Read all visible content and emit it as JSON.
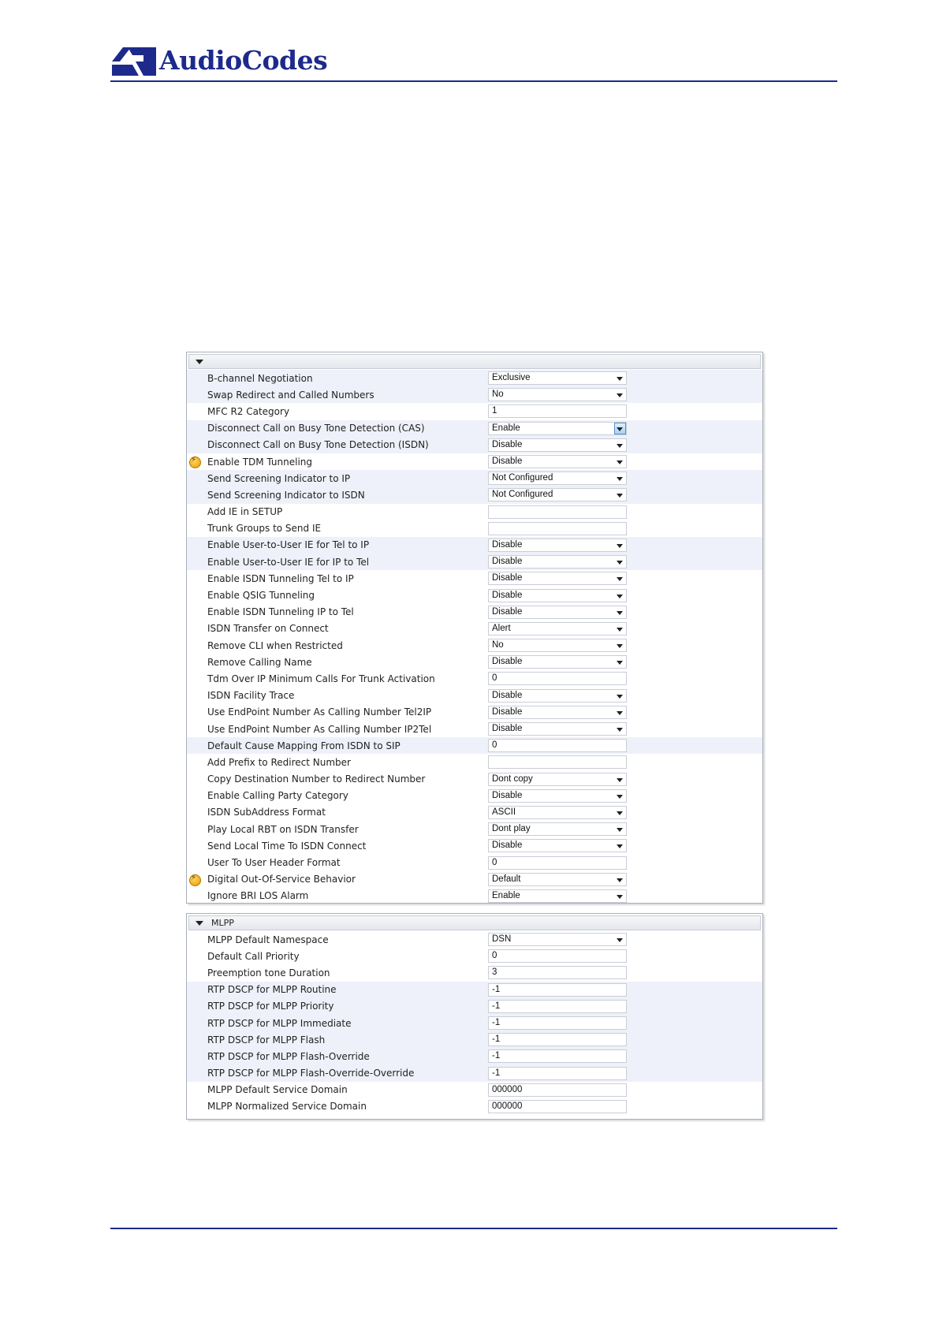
{
  "header": {
    "brand": "AudioCodes"
  },
  "colors": {
    "brand": "#1d2a8c",
    "row_alt": "#eef1f9",
    "border": "#a9b0ba"
  },
  "panel1": {
    "title": "",
    "rows": [
      {
        "label": "B-channel Negotiation",
        "value": "Exclusive",
        "type": "select"
      },
      {
        "label": "Swap Redirect and Called Numbers",
        "value": "No",
        "type": "select"
      },
      {
        "label": "MFC R2 Category",
        "value": "1",
        "type": "text"
      },
      {
        "label": "Disconnect Call on Busy Tone Detection (CAS)",
        "value": "Enable",
        "type": "select",
        "focused": true
      },
      {
        "label": "Disconnect Call on Busy Tone Detection (ISDN)",
        "value": "Disable",
        "type": "select"
      },
      {
        "label": "Enable TDM Tunneling",
        "value": "Disable",
        "type": "select",
        "flag": true
      },
      {
        "label": "Send Screening Indicator to IP",
        "value": "Not Configured",
        "type": "select"
      },
      {
        "label": "Send Screening Indicator to ISDN",
        "value": "Not Configured",
        "type": "select"
      },
      {
        "label": "Add IE in SETUP",
        "value": "",
        "type": "text"
      },
      {
        "label": "Trunk Groups to Send IE",
        "value": "",
        "type": "text"
      },
      {
        "label": "Enable User-to-User IE for Tel to IP",
        "value": "Disable",
        "type": "select"
      },
      {
        "label": "Enable User-to-User IE for IP to Tel",
        "value": "Disable",
        "type": "select"
      },
      {
        "label": "Enable ISDN Tunneling Tel to IP",
        "value": "Disable",
        "type": "select"
      },
      {
        "label": "Enable QSIG Tunneling",
        "value": "Disable",
        "type": "select"
      },
      {
        "label": "Enable ISDN Tunneling IP to Tel",
        "value": "Disable",
        "type": "select"
      },
      {
        "label": "ISDN Transfer on Connect",
        "value": "Alert",
        "type": "select"
      },
      {
        "label": "Remove CLI when Restricted",
        "value": "No",
        "type": "select"
      },
      {
        "label": "Remove Calling Name",
        "value": "Disable",
        "type": "select"
      },
      {
        "label": "Tdm Over IP Minimum Calls For Trunk Activation",
        "value": "0",
        "type": "text"
      },
      {
        "label": "ISDN Facility Trace",
        "value": "Disable",
        "type": "select"
      },
      {
        "label": "Use EndPoint Number As Calling Number Tel2IP",
        "value": "Disable",
        "type": "select"
      },
      {
        "label": "Use EndPoint Number As Calling Number IP2Tel",
        "value": "Disable",
        "type": "select"
      },
      {
        "label": "Default Cause Mapping From ISDN to SIP",
        "value": "0",
        "type": "text"
      },
      {
        "label": "Add Prefix to Redirect Number",
        "value": "",
        "type": "text"
      },
      {
        "label": "Copy Destination Number to Redirect Number",
        "value": "Dont copy",
        "type": "select"
      },
      {
        "label": "Enable Calling Party Category",
        "value": "Disable",
        "type": "select"
      },
      {
        "label": "ISDN SubAddress Format",
        "value": "ASCII",
        "type": "select"
      },
      {
        "label": "Play Local RBT on ISDN Transfer",
        "value": "Dont play",
        "type": "select"
      },
      {
        "label": "Send Local Time To ISDN Connect",
        "value": "Disable",
        "type": "select"
      },
      {
        "label": "User To User Header Format",
        "value": "0",
        "type": "text"
      },
      {
        "label": "Digital Out-Of-Service Behavior",
        "value": "Default",
        "type": "select",
        "flag": true
      },
      {
        "label": "Ignore BRI LOS Alarm",
        "value": "Enable",
        "type": "select"
      }
    ]
  },
  "panel2": {
    "title": "MLPP",
    "rows": [
      {
        "label": "MLPP Default Namespace",
        "value": "DSN",
        "type": "select"
      },
      {
        "label": "Default Call Priority",
        "value": "0",
        "type": "text"
      },
      {
        "label": "Preemption tone Duration",
        "value": "3",
        "type": "text"
      },
      {
        "label": "RTP DSCP for MLPP Routine",
        "value": "-1",
        "type": "text"
      },
      {
        "label": "RTP DSCP for MLPP Priority",
        "value": "-1",
        "type": "text"
      },
      {
        "label": "RTP DSCP for MLPP Immediate",
        "value": "-1",
        "type": "text"
      },
      {
        "label": "RTP DSCP for MLPP Flash",
        "value": "-1",
        "type": "text"
      },
      {
        "label": "RTP DSCP for MLPP Flash-Override",
        "value": "-1",
        "type": "text"
      },
      {
        "label": "RTP DSCP for MLPP Flash-Override-Override",
        "value": "-1",
        "type": "text"
      },
      {
        "label": "MLPP Default Service Domain",
        "value": "000000",
        "type": "text"
      },
      {
        "label": "MLPP Normalized Service Domain",
        "value": "000000",
        "type": "text"
      }
    ]
  }
}
